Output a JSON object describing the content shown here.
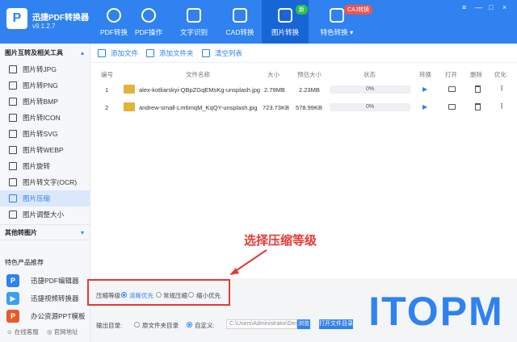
{
  "app": {
    "title": "迅捷PDF转换器",
    "version": "v9.1.2.7"
  },
  "nav": {
    "tabs": [
      {
        "label": "PDF转换",
        "icon": "refresh-icon"
      },
      {
        "label": "PDF操作",
        "icon": "target-icon"
      },
      {
        "label": "文字识别",
        "icon": "ocr-icon"
      },
      {
        "label": "CAD转换",
        "icon": "cad-icon"
      },
      {
        "label": "图片转换",
        "icon": "image-icon",
        "active": true
      },
      {
        "label": "特色转换",
        "icon": "special-icon"
      }
    ],
    "badge_new": "新",
    "badge_ca": "CAJ转换",
    "window_controls": [
      "≡",
      "—",
      "□",
      "×"
    ]
  },
  "sidebar": {
    "section_title": "图片互转及相关工具",
    "items": [
      {
        "label": "图片转JPG"
      },
      {
        "label": "图片转PNG"
      },
      {
        "label": "图片转BMP"
      },
      {
        "label": "图片转ICON"
      },
      {
        "label": "图片转SVG"
      },
      {
        "label": "图片转WEBP"
      },
      {
        "label": "图片旋转"
      },
      {
        "label": "图片转文字(OCR)"
      },
      {
        "label": "图片压缩",
        "active": true
      },
      {
        "label": "图片调整大小"
      }
    ],
    "other_section": "其他转图片",
    "feature_title": "特色产品推荐",
    "features": [
      {
        "label": "迅捷PDF编辑器"
      },
      {
        "label": "迅捷视频转换器"
      },
      {
        "label": "办公资源PPT模板"
      }
    ],
    "bottom_links": [
      "在线客服",
      "官网地址"
    ]
  },
  "toolbar": {
    "add_file": "添加文件",
    "add_folder": "添加文件夹",
    "clear_list": "清空列表"
  },
  "table": {
    "headers": [
      "编号",
      "文件名称",
      "大小",
      "预估大小",
      "状态",
      "转换",
      "打开",
      "删除",
      "优化"
    ],
    "rows": [
      {
        "index": "1",
        "name": "alex-kotliarskyi-QBpZGqEMsKg-unsplash.jpg",
        "size": "2.79MB",
        "estimated": "2.23MB",
        "progress": "0%",
        "progress_value": 0
      },
      {
        "index": "2",
        "name": "andrew-small-Lm6mqM_KqQY-unsplash.jpg",
        "size": "723.73KB",
        "estimated": "578.99KB",
        "progress": "0%",
        "progress_value": 0
      }
    ]
  },
  "annotation": "选择压缩等级",
  "compress": {
    "label": "压缩等级:",
    "options": [
      "清晰优先",
      "常规压缩",
      "缩小优先"
    ],
    "selected": 0
  },
  "output": {
    "label": "输出目录:",
    "options": [
      "原文件夹目录",
      "自定义:"
    ],
    "selected": 1,
    "path": "C:\\Users\\Administrator\\Des",
    "browse": "浏览",
    "open_folder": "打开文件目录"
  },
  "watermark": "ITOPM",
  "colors": {
    "primary": "#2f82f0",
    "annotation": "#e53935",
    "new_badge": "#2ec04a",
    "ca_badge": "#ef5350"
  }
}
